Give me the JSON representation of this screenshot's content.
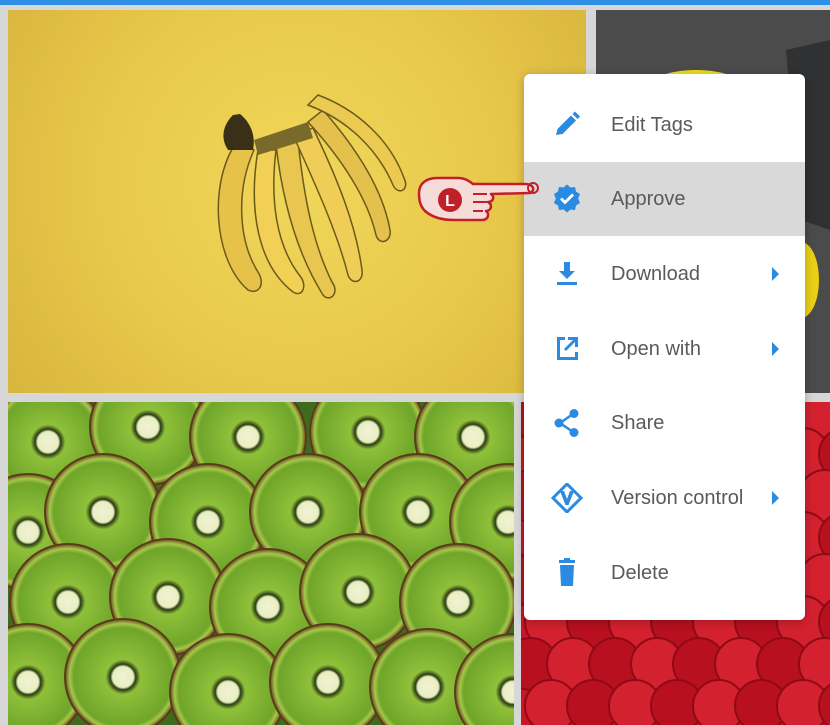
{
  "menu": {
    "items": [
      {
        "label": "Edit Tags",
        "icon": "pencil-icon",
        "submenu": false,
        "active": false
      },
      {
        "label": "Approve",
        "icon": "verified-badge-icon",
        "submenu": false,
        "active": true
      },
      {
        "label": "Download",
        "icon": "download-icon",
        "submenu": true,
        "active": false
      },
      {
        "label": "Open with",
        "icon": "external-link-icon",
        "submenu": true,
        "active": false
      },
      {
        "label": "Share",
        "icon": "share-icon",
        "submenu": false,
        "active": false
      },
      {
        "label": "Version control",
        "icon": "version-control-icon",
        "submenu": true,
        "active": false
      },
      {
        "label": "Delete",
        "icon": "trash-icon",
        "submenu": false,
        "active": false
      }
    ]
  },
  "cursor": {
    "badge": "L",
    "icon": "hand-pointer-icon"
  },
  "gallery": {
    "tiles": [
      {
        "subject": "bananas",
        "bg": "#e8c84a"
      },
      {
        "subject": "lemon",
        "bg": "#4b4b4b"
      },
      {
        "subject": "kiwi slices",
        "bg": "#3f6b1e"
      },
      {
        "subject": "raspberries",
        "bg": "#c91526"
      }
    ]
  },
  "colors": {
    "accent": "#2b8ae2",
    "highlight": "#d9d9d9",
    "menu_text": "#5a5a5a",
    "cursor": "#c0202a"
  }
}
